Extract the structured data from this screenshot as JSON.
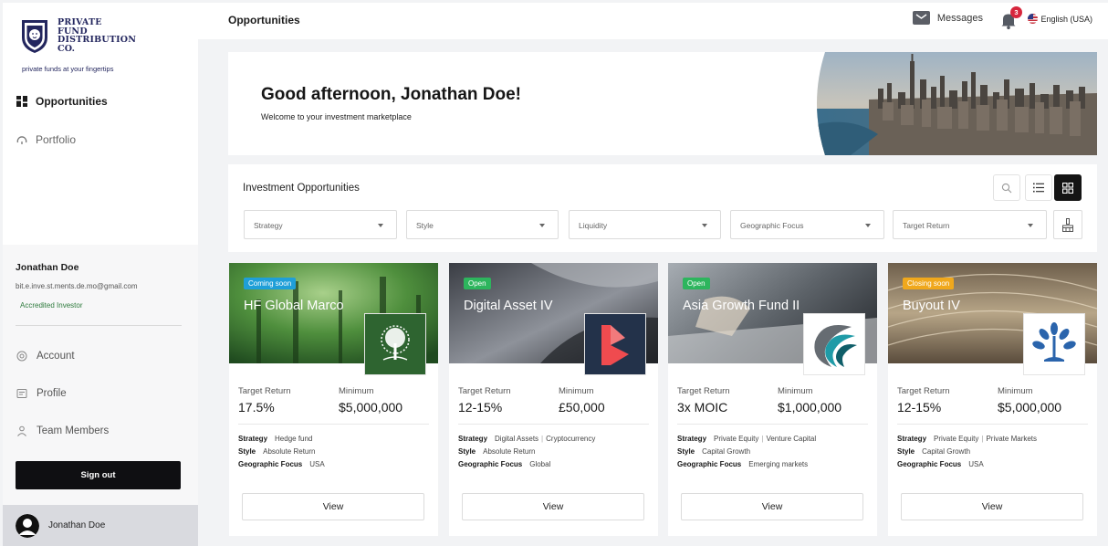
{
  "brand": {
    "name_lines": [
      "PRIVATE",
      "FUND",
      "DISTRIBUTION",
      "CO."
    ],
    "tagline": "private funds at your fingertips"
  },
  "nav": {
    "items": [
      {
        "label": "Opportunities",
        "icon": "grid-icon",
        "active": true
      },
      {
        "label": "Portfolio",
        "icon": "gauge-icon",
        "active": false
      }
    ]
  },
  "user": {
    "name": "Jonathan Doe",
    "email": "bit.e.inve.st.ments.de.mo@gmail.com",
    "badge": "Accredited Investor",
    "links": [
      {
        "label": "Account",
        "icon": "settings-icon"
      },
      {
        "label": "Profile",
        "icon": "id-card-icon"
      },
      {
        "label": "Team Members",
        "icon": "person-icon"
      }
    ],
    "signout_label": "Sign out"
  },
  "topbar": {
    "page_title": "Opportunities",
    "messages_label": "Messages",
    "notification_count": "3",
    "language": "English (USA)"
  },
  "banner": {
    "greeting": "Good afternoon, Jonathan Doe!",
    "subtitle": "Welcome to your investment marketplace"
  },
  "filters": {
    "title": "Investment Opportunities",
    "selects": [
      {
        "placeholder": "Strategy"
      },
      {
        "placeholder": "Style"
      },
      {
        "placeholder": "Liquidity"
      },
      {
        "placeholder": "Geographic Focus"
      },
      {
        "placeholder": "Target Return"
      }
    ]
  },
  "labels": {
    "target_return": "Target Return",
    "minimum": "Minimum",
    "strategy": "Strategy",
    "style": "Style",
    "geo": "Geographic Focus",
    "view": "View"
  },
  "cards": [
    {
      "status": "Coming soon",
      "status_color": "#1f9fd8",
      "name": "HF Global Marco",
      "target_return": "17.5%",
      "minimum": "$5,000,000",
      "strategy": [
        "Hedge fund"
      ],
      "style": "Absolute Return",
      "geo": "USA",
      "logo": "tree-logo-icon"
    },
    {
      "status": "Open",
      "status_color": "#2db55d",
      "name": "Digital Asset IV",
      "target_return": "12-15%",
      "minimum": "£50,000",
      "strategy": [
        "Digital Assets",
        "Cryptocurrency"
      ],
      "style": "Absolute Return",
      "geo": "Global",
      "logo": "b-letter-logo-icon"
    },
    {
      "status": "Open",
      "status_color": "#2db55d",
      "name": "Asia Growth Fund II",
      "target_return": "3x MOIC",
      "minimum": "$1,000,000",
      "strategy": [
        "Private Equity",
        "Venture Capital"
      ],
      "style": "Capital Growth",
      "geo": "Emerging markets",
      "logo": "swirl-logo-icon"
    },
    {
      "status": "Closing soon",
      "status_color": "#f0a81c",
      "name": "Buyout IV",
      "target_return": "12-15%",
      "minimum": "$5,000,000",
      "strategy": [
        "Private Equity",
        "Private Markets"
      ],
      "style": "Capital Growth",
      "geo": "USA",
      "logo": "blue-tree-logo-icon"
    }
  ]
}
